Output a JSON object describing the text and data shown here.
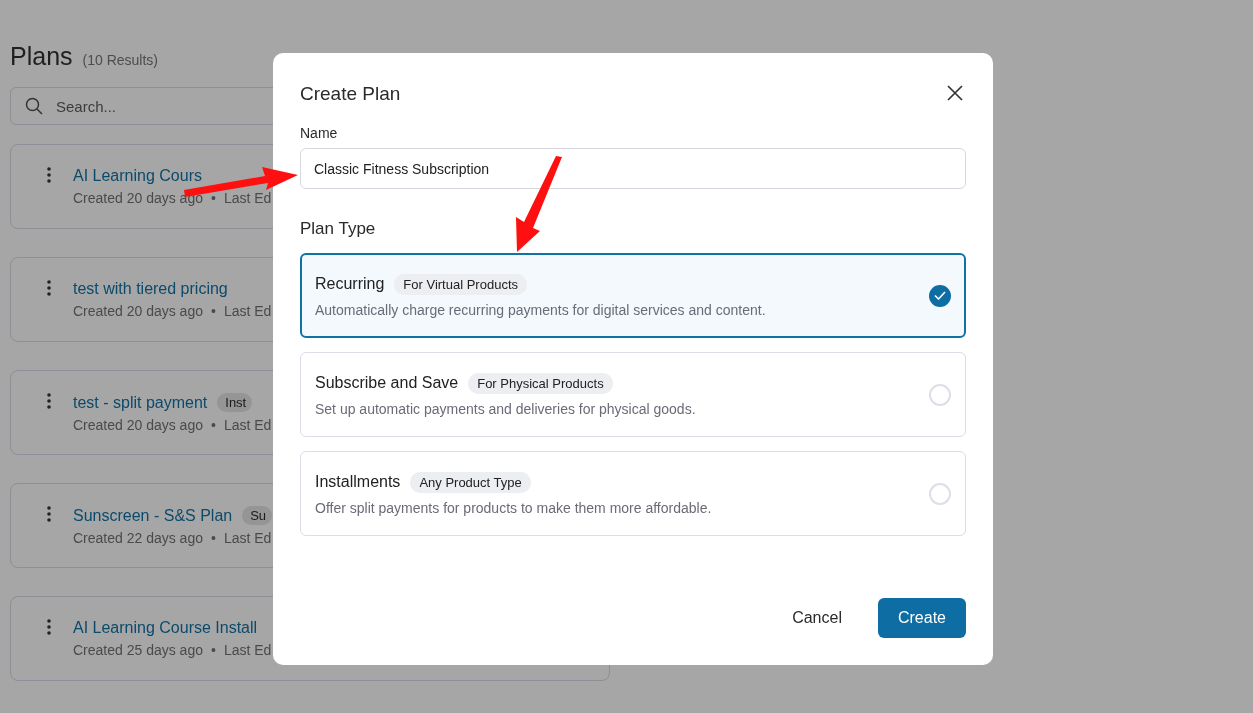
{
  "page": {
    "title": "Plans",
    "count": "(10 Results)",
    "search": {
      "placeholder": "Search..."
    }
  },
  "plans": [
    {
      "name": "AI Learning Cours",
      "created": "Created 20 days ago",
      "separator": "•",
      "edited": "Last Ed"
    },
    {
      "name": "test with tiered pricing",
      "created": "Created 20 days ago",
      "separator": "•",
      "edited": "Last Ed"
    },
    {
      "name": "test - split payment",
      "tag": "Inst",
      "created": "Created 20 days ago",
      "separator": "•",
      "edited": "Last Ed"
    },
    {
      "name": "Sunscreen - S&S Plan",
      "tag": "Su",
      "created": "Created 22 days ago",
      "separator": "•",
      "edited": "Last Ed"
    },
    {
      "name": "AI Learning Course Install",
      "created": "Created 25 days ago",
      "separator": "•",
      "edited": "Last Ed"
    }
  ],
  "dialog": {
    "title": "Create Plan",
    "name_label": "Name",
    "name_value": "Classic Fitness Subscription",
    "type_label": "Plan Type",
    "options": [
      {
        "title": "Recurring",
        "tag": "For Virtual Products",
        "description": "Automatically charge recurring payments for digital services and content.",
        "selected": true
      },
      {
        "title": "Subscribe and Save",
        "tag": "For Physical Products",
        "description": "Set up automatic payments and deliveries for physical goods.",
        "selected": false
      },
      {
        "title": "Installments",
        "tag": "Any Product Type",
        "description": "Offer split payments for products to make them more affordable.",
        "selected": false
      }
    ],
    "buttons": [
      {
        "label": "Cancel",
        "kind": "secondary"
      },
      {
        "label": "Create",
        "kind": "primary"
      }
    ]
  }
}
